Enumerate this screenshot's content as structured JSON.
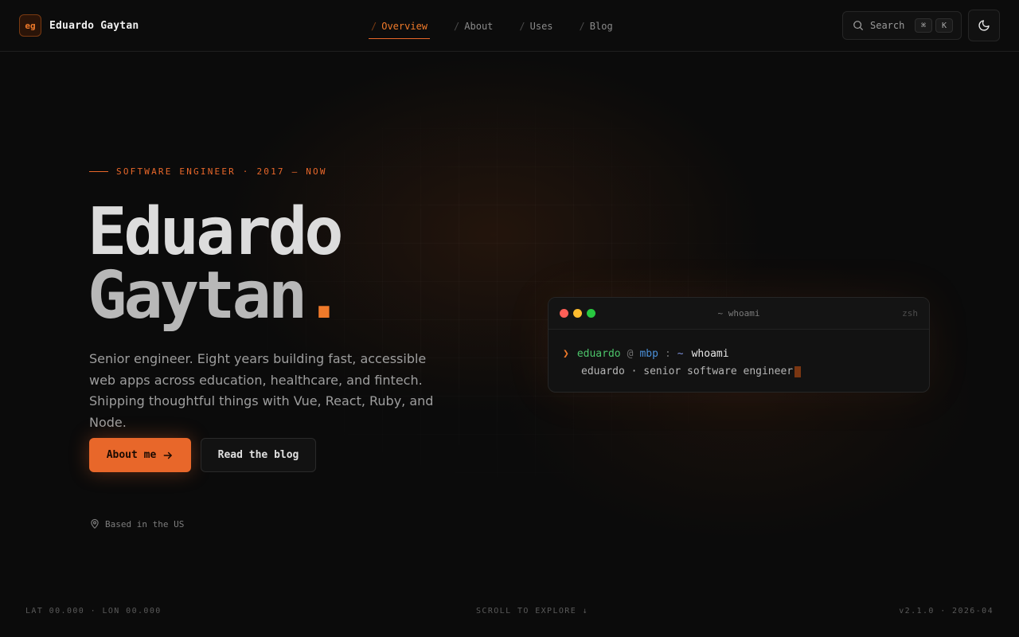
{
  "header": {
    "logo_text": "eg",
    "name": "Eduardo Gaytan",
    "nav": [
      {
        "slash": "/",
        "label": "Overview",
        "active": true
      },
      {
        "slash": "/",
        "label": "About",
        "active": false
      },
      {
        "slash": "/",
        "label": "Uses",
        "active": false
      },
      {
        "slash": "/",
        "label": "Blog",
        "active": false
      }
    ],
    "search": {
      "label": "Search",
      "kbd_1": "⌘",
      "kbd_2": "K",
      "icon": "search-icon"
    },
    "theme_toggle_icon": "moon-icon"
  },
  "hero": {
    "eyebrow": "SOFTWARE ENGINEER · 2017 — NOW",
    "title_line1": "Eduardo",
    "title_line2": "Gaytan",
    "title_dot": ".",
    "bio": "Senior engineer. Eight years building fast, accessible web apps across education, healthcare, and fintech. Shipping thoughtful things with Vue, React, Ruby, and Node.",
    "primary_button": "About me",
    "primary_button_icon": "arrow-right-icon",
    "secondary_button": "Read the blog",
    "location": "Based in the US",
    "location_icon": "map-pin-icon"
  },
  "terminal": {
    "title": "~ whoami",
    "shell": "zsh",
    "prompt_arrow": "❯",
    "user": "eduardo",
    "at": "@",
    "host": "mbp",
    "colon": ":",
    "path": "~",
    "command": "whoami",
    "output": "eduardo · senior software engineer",
    "dots": [
      "#ff5f57",
      "#febc2e",
      "#28c840"
    ]
  },
  "footer": {
    "coords": "LAT 00.000 · LON 00.000",
    "scroll": "SCROLL TO EXPLORE ↓",
    "version": "v2.1.0 · 2026-04"
  },
  "colors": {
    "accent": "#e8672a",
    "background": "#0b0b0b"
  }
}
